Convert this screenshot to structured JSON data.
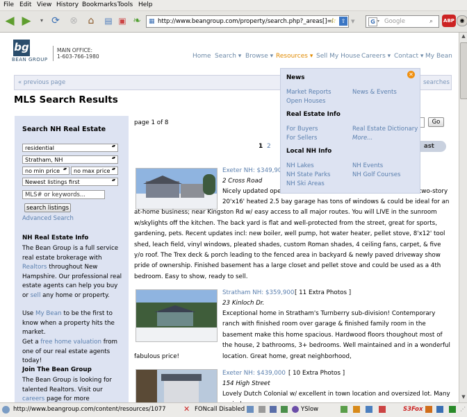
{
  "browser": {
    "menu": [
      "File",
      "Edit",
      "View",
      "History",
      "Bookmarks",
      "Tools",
      "Help"
    ],
    "url": "http://www.beangroup.com/property/search.php?_areas[]=Ex",
    "search_placeholder": "Google",
    "status_url": "http://www.beangroup.com/content/resources/1077",
    "status_items": {
      "fon": "FONcall Disabled",
      "yslow": "YSlow",
      "s3fox": "S3Fox"
    }
  },
  "site": {
    "logo_text": "bg",
    "logo_sub": "BEAN GROUP",
    "office_label": "MAIN OFFICE:",
    "office_phone": "1-603-766-1980",
    "nav": [
      "Home",
      "Search ▾",
      "Browse ▾",
      "Resources ▾",
      "Sell My House",
      "Careers ▾",
      "Contact ▾",
      "My Bean"
    ],
    "prev_page": "« previous page",
    "searches_fragment": "searches",
    "page_title": "MLS Search Results",
    "page_info": "page 1 of 8",
    "go_label": "Go",
    "pages": [
      "1",
      "2"
    ],
    "last_fragment": "ast"
  },
  "dropdown": {
    "sections": [
      {
        "title": "News",
        "items": [
          [
            "Market Reports",
            "News & Events"
          ],
          [
            "Open Houses",
            ""
          ]
        ]
      },
      {
        "title": "Real Estate Info",
        "items": [
          [
            "For Buyers",
            "Real Estate Dictionary"
          ],
          [
            "For Sellers",
            "More..."
          ]
        ]
      },
      {
        "title": "Local NH Info",
        "items": [
          [
            "NH Lakes",
            "NH Events"
          ],
          [
            "NH State Parks",
            "NH Golf Courses"
          ],
          [
            "NH Ski Areas",
            ""
          ]
        ]
      }
    ]
  },
  "sidebar": {
    "search_title": "Search NH Real Estate",
    "type_value": "residential",
    "town_value": "Stratham, NH",
    "min_price": "no min price",
    "max_price": "no max price",
    "sort_value": "Newest listings first",
    "mls_placeholder": "MLS# or keywords...",
    "search_button": "search listings",
    "advanced": "Advanced Search",
    "info_title": "NH Real Estate Info",
    "info_text_1": "The Bean Group is a full service real estate brokerage with",
    "info_link_realtors": "Realtors",
    "info_text_2": "throughout New Hampshire. Our professional real estate agents can help you buy or",
    "info_link_sell": "sell",
    "info_text_3": "any home or property.",
    "use_text_1": "Use",
    "use_link": "My Bean",
    "use_text_2": "to be the first to know when a property hits the market.",
    "get_text_1": "Get a",
    "get_link": "free home valuation",
    "get_text_2": "from one of our real estate agents today!",
    "join_title": "Join The Bean Group",
    "join_text_1": "The Bean Group is looking for talented Realtors. Visit our",
    "join_link": "careers",
    "join_text_2": "page for more information now."
  },
  "listings": [
    {
      "location_price": "Exeter NH: $349,900",
      "address": "2 Cross Road",
      "line1_start": "Nicely updated oper",
      "line1_end": "two-story",
      "rest": "20'x16' heated 2.5 bay garage has tons of windows & could be ideal for an at-home business; near Kingston Rd w/ easy access to all major routes. You will LIVE in the sunroom w/skylights off the kitchen. The back yard is flat and well-protected from the street, great for sports, gardening, pets. Recent updates incl: new boiler, well pump, hot water heater, pellet stove, 8'x12' tool shed, leach field, vinyl windows, pleated shades, custom Roman shades, 4 ceiling fans, carpet, & five y/o roof. The Trex deck & porch leading to the fenced area in backyard & newly paved driveway show pride of ownership. Finished basement has a large closet and pellet stove and could be used as a 4th bedroom. Easy to show, ready to sell."
    },
    {
      "location_price": "Stratham NH: $359,900",
      "photos": "[ 11 Extra Photos ]",
      "address": "23 Kinloch Dr.",
      "text": "Exceptional home in Stratham's Turnberry sub-division! Contemporary ranch with finished room over garage & finished family room in the basement make this home spacious. Hardwood floors thoughout most of the house, 2 bathrooms, 3+ bedrooms. Well maintained and in a wonderful location. Great home, great neighborhood,",
      "text_end": "fabulous price!"
    },
    {
      "location_price": "Exeter NH: $439,000",
      "photos": "[ 10 Extra Photos ]",
      "address": "154 High Street",
      "text": "Lovely Dutch Colonial w/ excellent in town location and oversized lot. Many period"
    }
  ]
}
